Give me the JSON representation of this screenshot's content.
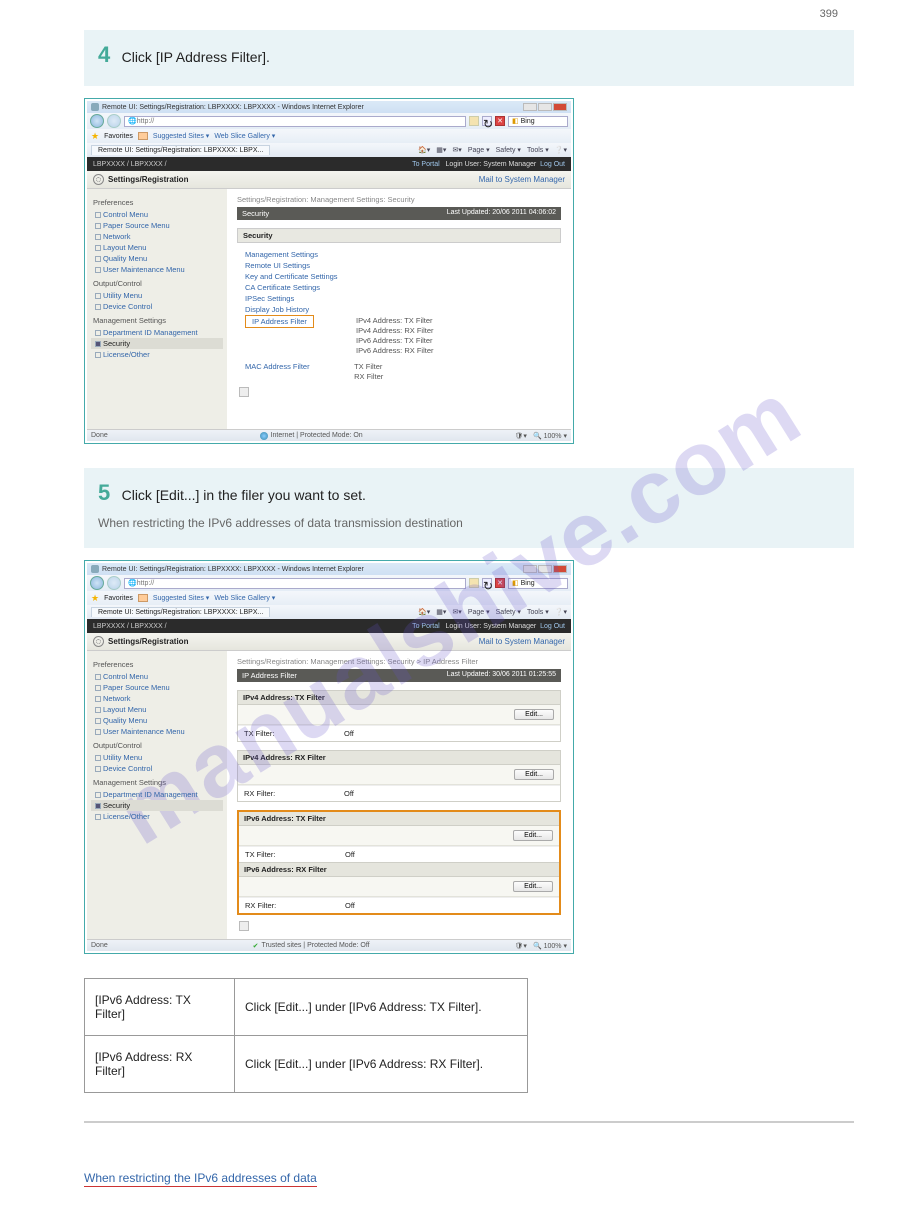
{
  "page_number": "399",
  "watermark": "manualshive.com",
  "step4": {
    "num": "4",
    "title": "Click [IP Address Filter].",
    "window_title": "Remote UI: Settings/Registration: LBPXXXX: LBPXXXX - Windows Internet Explorer",
    "url": "http://",
    "search": "Bing",
    "fav_label": "Favorites",
    "sugg": "Suggested Sites ▾",
    "slice": "Web Slice Gallery ▾",
    "tab": "Remote UI: Settings/Registration: LBPXXXX: LBPX...",
    "cmd": {
      "page": "Page ▾",
      "safety": "Safety ▾",
      "tools": "Tools ▾"
    },
    "portal_left": "LBPXXXX / LBPXXXX /",
    "portal_right_a": "To Portal",
    "portal_right_b": "Login User: System Manager",
    "portal_right_c": "Log Out",
    "hd": "Settings/Registration",
    "mail": "Mail to System Manager",
    "sidebar": {
      "g1": "Preferences",
      "i1": "Control Menu",
      "i2": "Paper Source Menu",
      "i3": "Network",
      "i4": "Layout Menu",
      "i5": "Quality Menu",
      "i6": "User Maintenance Menu",
      "g2": "Output/Control",
      "i7": "Utility Menu",
      "i8": "Device Control",
      "g3": "Management Settings",
      "i9": "Department ID Management",
      "i10": "Security",
      "i11": "License/Other"
    },
    "crumb": "Settings/Registration: Management Settings: Security",
    "bar": "Security",
    "bar_r": "Last Updated: 20/06 2011 04:06:02",
    "subh": "Security",
    "links": {
      "l1": "Management Settings",
      "l2": "Remote UI Settings",
      "l3": "Key and Certificate Settings",
      "l4": "CA Certificate Settings",
      "l5": "IPSec Settings",
      "l6": "Display Job History",
      "l7": "IP Address Filter",
      "l8": "MAC Address Filter"
    },
    "sub1": {
      "a": "IPv4 Address: TX Filter",
      "b": "IPv4 Address: RX Filter",
      "c": "IPv6 Address: TX Filter",
      "d": "IPv6 Address: RX Filter"
    },
    "sub2": {
      "a": "TX Filter",
      "b": "RX Filter"
    },
    "status_mid": "Internet | Protected Mode: On",
    "status_done": "Done",
    "status_zoom": "100%  ▾"
  },
  "step5": {
    "num": "5",
    "title": "Click [Edit...] in the filer you want to set.",
    "sub": "When restricting the IPv6 addresses of data transmission destination",
    "window_title": "Remote UI: Settings/Registration: LBPXXXX: LBPXXXX - Windows Internet Explorer",
    "crumb": "Settings/Registration: Management Settings: Security > IP Address Filter",
    "bar": "IP Address Filter",
    "bar_r": "Last Updated: 30/06 2011 01:25:55",
    "f1": {
      "h": "IPv4 Address: TX Filter",
      "k": "TX Filter:",
      "v": "Off",
      "btn": "Edit..."
    },
    "f2": {
      "h": "IPv4 Address: RX Filter",
      "k": "RX Filter:",
      "v": "Off",
      "btn": "Edit..."
    },
    "f3": {
      "h": "IPv6 Address: TX Filter",
      "k": "TX Filter:",
      "v": "Off",
      "btn": "Edit..."
    },
    "f4": {
      "h": "IPv6 Address: RX Filter",
      "k": "RX Filter:",
      "v": "Off",
      "btn": "Edit..."
    },
    "status_mid": "Trusted sites | Protected Mode: Off",
    "status_zoom": "100%  ▾"
  },
  "doc_table": {
    "r1a": "[IPv6 Address: TX Filter]",
    "r1b": "Click [Edit...] under [IPv6 Address: TX Filter].",
    "r2a": "[IPv6 Address: RX Filter]",
    "r2b": "Click [Edit...] under [IPv6 Address: RX Filter]."
  },
  "foot_link": "When restricting the IPv6 addresses of data"
}
